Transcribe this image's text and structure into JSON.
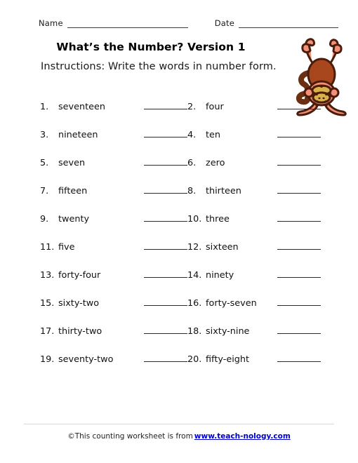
{
  "header": {
    "name_label": "Name",
    "date_label": "Date"
  },
  "title": "What’s the Number? Version 1",
  "instructions": "Instructions: Write the words in number form.",
  "clipart": {
    "name": "monkey-handstand-clipart",
    "colors": {
      "limb": "#F4907A",
      "body": "#A8461E",
      "muzzle": "#D9B24C",
      "tail": "#6B3012",
      "outline": "#4A1D0A"
    }
  },
  "questions": [
    {
      "number": "1.",
      "word": "seventeen"
    },
    {
      "number": "2.",
      "word": "four"
    },
    {
      "number": "3.",
      "word": "nineteen"
    },
    {
      "number": "4.",
      "word": "ten"
    },
    {
      "number": "5.",
      "word": "seven"
    },
    {
      "number": "6.",
      "word": "zero"
    },
    {
      "number": "7.",
      "word": "fifteen"
    },
    {
      "number": "8.",
      "word": "thirteen"
    },
    {
      "number": "9.",
      "word": "twenty"
    },
    {
      "number": "10.",
      "word": "three"
    },
    {
      "number": "11.",
      "word": "five"
    },
    {
      "number": "12.",
      "word": "sixteen"
    },
    {
      "number": "13.",
      "word": "forty-four"
    },
    {
      "number": "14.",
      "word": "ninety"
    },
    {
      "number": "15.",
      "word": "sixty-two"
    },
    {
      "number": "16.",
      "word": "forty-seven"
    },
    {
      "number": "17.",
      "word": "thirty-two"
    },
    {
      "number": "18.",
      "word": "sixty-nine"
    },
    {
      "number": "19.",
      "word": "seventy-two"
    },
    {
      "number": "20.",
      "word": "fifty-eight"
    }
  ],
  "footer": {
    "text": "©This counting worksheet is from",
    "link": "www.teach-nology.com",
    "link_color": "#0000cc"
  }
}
